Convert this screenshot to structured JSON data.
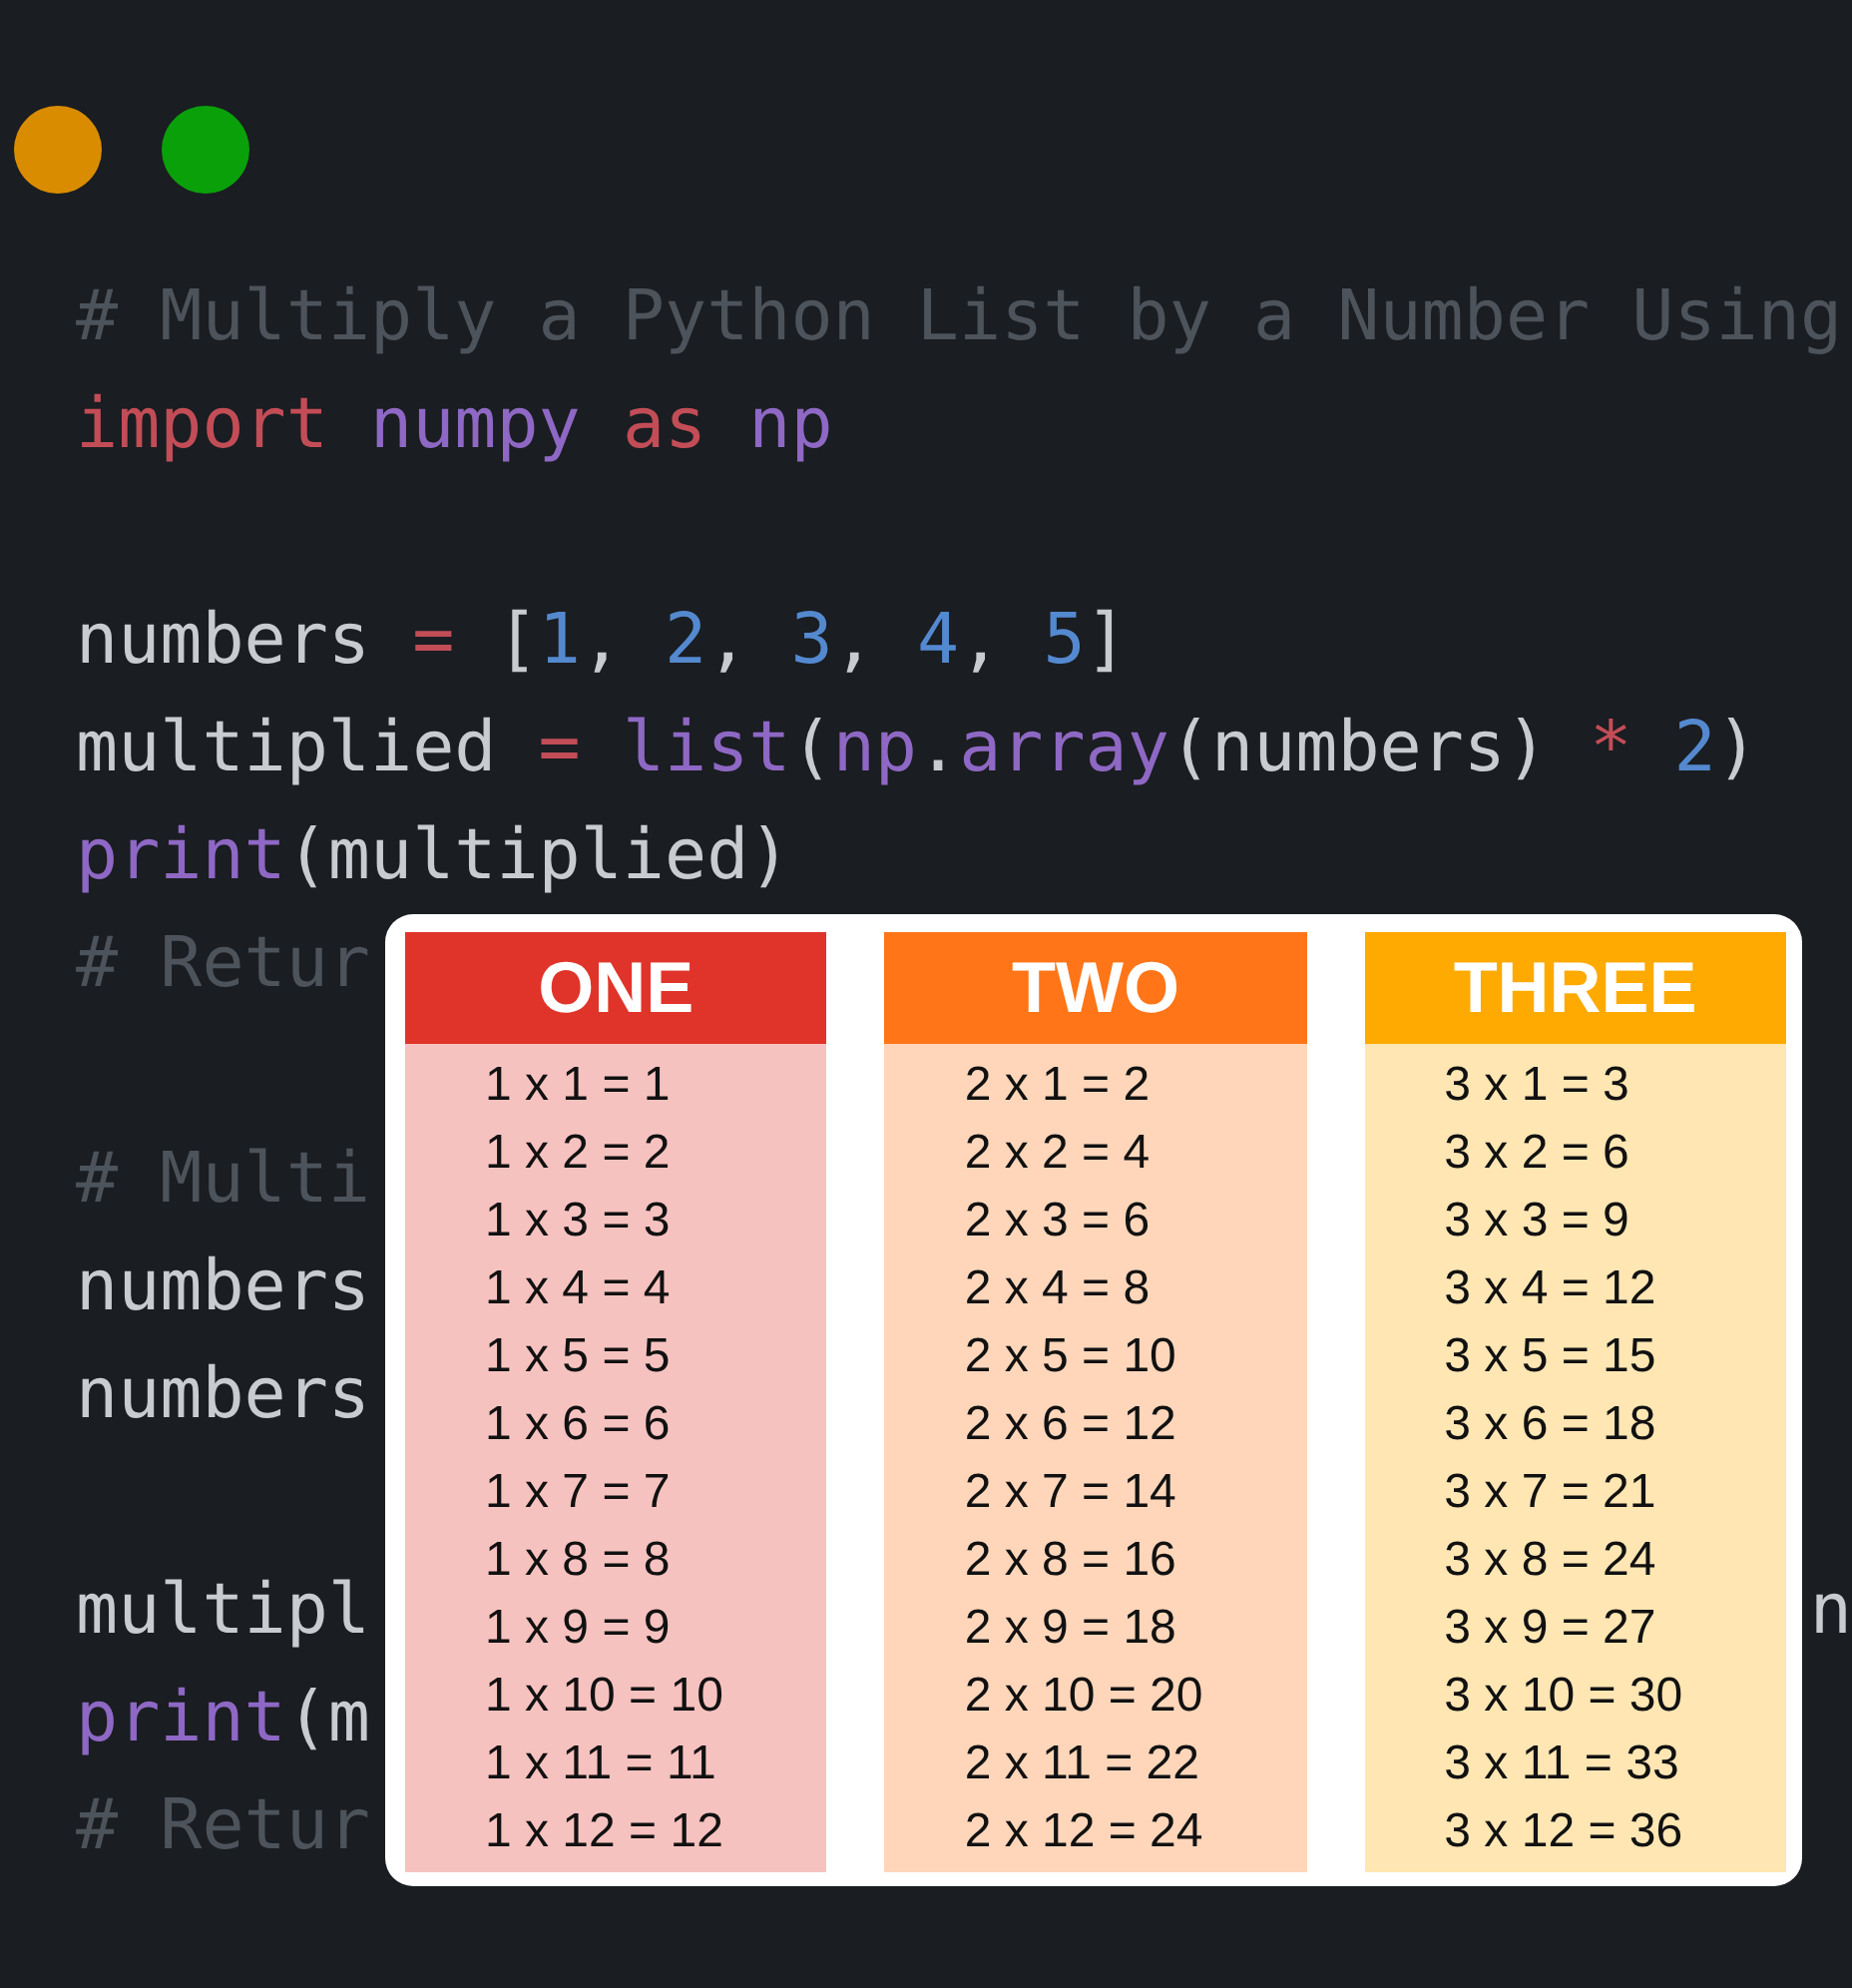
{
  "window_controls": [
    {
      "color": "#da8c00"
    },
    {
      "color": "#0aa00a"
    }
  ],
  "code_lines": [
    {
      "kind": "code",
      "tokens": [
        {
          "kind": "comment",
          "text": "# Multiply a Python List by a Number Using"
        }
      ]
    },
    {
      "kind": "code",
      "tokens": [
        {
          "kind": "keyword",
          "text": "import "
        },
        {
          "kind": "name",
          "text": "numpy "
        },
        {
          "kind": "keyword",
          "text": "as "
        },
        {
          "kind": "name",
          "text": "np"
        }
      ]
    },
    {
      "kind": "blank"
    },
    {
      "kind": "code",
      "tokens": [
        {
          "kind": "plain",
          "text": "numbers "
        },
        {
          "kind": "keyword",
          "text": "="
        },
        {
          "kind": "plain",
          "text": " ["
        },
        {
          "kind": "number",
          "text": "1"
        },
        {
          "kind": "plain",
          "text": ", "
        },
        {
          "kind": "number",
          "text": "2"
        },
        {
          "kind": "plain",
          "text": ", "
        },
        {
          "kind": "number",
          "text": "3"
        },
        {
          "kind": "plain",
          "text": ", "
        },
        {
          "kind": "number",
          "text": "4"
        },
        {
          "kind": "plain",
          "text": ", "
        },
        {
          "kind": "number",
          "text": "5"
        },
        {
          "kind": "plain",
          "text": "]"
        }
      ]
    },
    {
      "kind": "code",
      "tokens": [
        {
          "kind": "plain",
          "text": "multiplied "
        },
        {
          "kind": "keyword",
          "text": "= "
        },
        {
          "kind": "name",
          "text": "list"
        },
        {
          "kind": "plain",
          "text": "("
        },
        {
          "kind": "name",
          "text": "np"
        },
        {
          "kind": "plain",
          "text": "."
        },
        {
          "kind": "name",
          "text": "array"
        },
        {
          "kind": "plain",
          "text": "(numbers) "
        },
        {
          "kind": "keyword",
          "text": "* "
        },
        {
          "kind": "number",
          "text": "2"
        },
        {
          "kind": "plain",
          "text": ")"
        }
      ]
    },
    {
      "kind": "code",
      "tokens": [
        {
          "kind": "name",
          "text": "print"
        },
        {
          "kind": "plain",
          "text": "(multiplied)"
        }
      ]
    },
    {
      "kind": "code",
      "tokens": [
        {
          "kind": "comment",
          "text": "# Retur"
        }
      ]
    },
    {
      "kind": "blank"
    },
    {
      "kind": "code",
      "tokens": [
        {
          "kind": "comment",
          "text": "# Multi"
        }
      ]
    },
    {
      "kind": "code",
      "tokens": [
        {
          "kind": "plain",
          "text": "numbers"
        }
      ]
    },
    {
      "kind": "code",
      "tokens": [
        {
          "kind": "plain",
          "text": "numbers"
        }
      ]
    },
    {
      "kind": "blank"
    },
    {
      "kind": "code",
      "tokens": [
        {
          "kind": "plain",
          "text": "multipl"
        }
      ],
      "tail": "n"
    },
    {
      "kind": "code",
      "tokens": [
        {
          "kind": "name",
          "text": "print"
        },
        {
          "kind": "plain",
          "text": "(m"
        }
      ]
    },
    {
      "kind": "code",
      "tokens": [
        {
          "kind": "comment",
          "text": "# Retur"
        }
      ]
    }
  ],
  "tables": [
    {
      "title": "ONE",
      "color": "#e0342a",
      "rows": [
        "1 x 1 = 1",
        "1 x 2 = 2",
        "1 x 3 = 3",
        "1 x 4 = 4",
        "1 x 5 = 5",
        "1 x 6 = 6",
        "1 x 7 = 7",
        "1 x 8 = 8",
        "1 x 9 = 9",
        "1 x 10 = 10",
        "1 x 11 = 11",
        "1 x 12 = 12"
      ]
    },
    {
      "title": "TWO",
      "color": "#ff7518",
      "rows": [
        "2 x 1 = 2",
        "2 x 2 = 4",
        "2 x 3 = 6",
        "2 x 4 = 8",
        "2 x 5 = 10",
        "2 x 6 = 12",
        "2 x 7 = 14",
        "2 x 8 = 16",
        "2 x 9 = 18",
        "2 x 10 = 20",
        "2 x 11 = 22",
        "2 x 12 = 24"
      ]
    },
    {
      "title": "THREE",
      "color": "#ffaa00",
      "rows": [
        "3 x 1 = 3",
        "3 x 2 = 6",
        "3 x 3 = 9",
        "3 x 4 = 12",
        "3 x 5 = 15",
        "3 x 6 = 18",
        "3 x 7 = 21",
        "3 x 8 = 24",
        "3 x 9 = 27",
        "3 x 10 = 30",
        "3 x 11 = 33",
        "3 x 12 = 36"
      ]
    }
  ]
}
